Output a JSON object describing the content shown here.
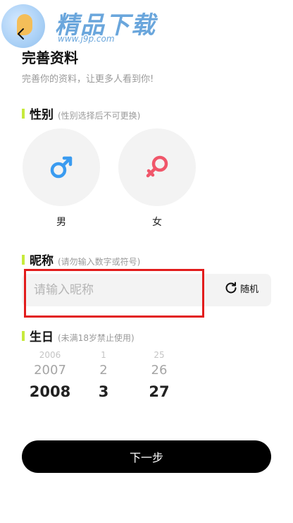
{
  "watermark": {
    "brand": "精品下载",
    "url": "www.j9p.com"
  },
  "header": {
    "title": "完善资料",
    "subtitle": "完善你的资料，让更多人看到你!"
  },
  "gender": {
    "label": "性别",
    "hint": "(性别选择后不可更换)",
    "options": [
      {
        "label": "男",
        "icon": "male-symbol-icon",
        "color": "#3a9bf0"
      },
      {
        "label": "女",
        "icon": "female-symbol-icon",
        "color": "#f0566a"
      }
    ]
  },
  "nickname": {
    "label": "昵称",
    "hint": "(请勿输入数字或符号)",
    "placeholder": "请输入昵称",
    "value": "",
    "random_label": "随机"
  },
  "birthday": {
    "label": "生日",
    "hint": "(未满18岁禁止使用)",
    "year": {
      "prev2": "2006",
      "prev1": "2007",
      "selected": "2008"
    },
    "month": {
      "prev2": "1",
      "prev1": "2",
      "selected": "3"
    },
    "day": {
      "prev2": "25",
      "prev1": "26",
      "selected": "27"
    }
  },
  "next_button": "下一步",
  "colors": {
    "accent_bar": "#c7ea3c",
    "highlight_frame": "#e21c1c",
    "button_bg": "#000000"
  }
}
